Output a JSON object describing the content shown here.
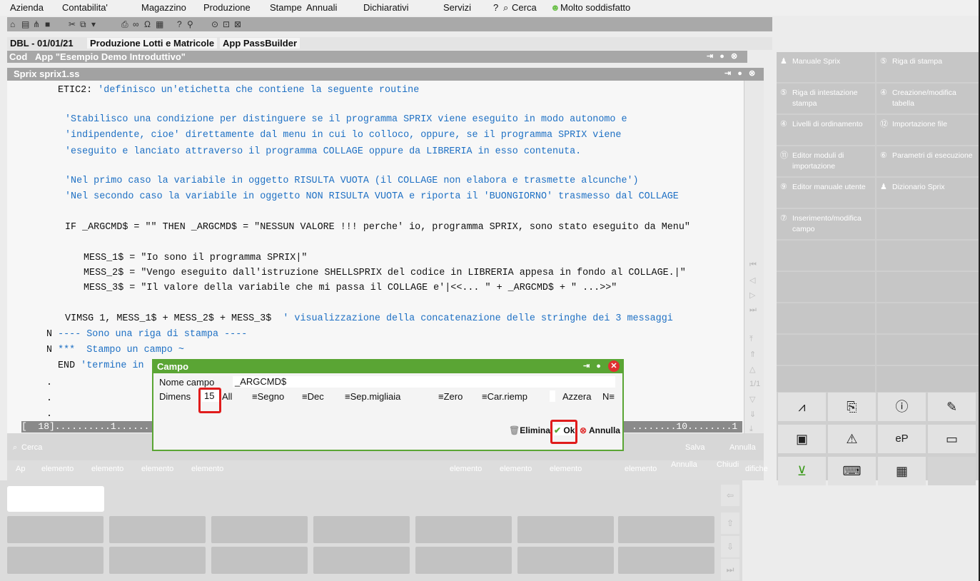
{
  "menubar": {
    "items": [
      "Azienda",
      "Contabilita'",
      "Magazzino",
      "Produzione",
      "Stampe",
      "Annuali",
      "Dichiarativi",
      "Servizi",
      "?",
      "Cerca",
      "Molto soddisfatto"
    ]
  },
  "appbar": {
    "date": "DBL - 01/01/21",
    "tab1": "Produzione Lotti e Matricole",
    "tab2": "App PassBuilder"
  },
  "window": {
    "prefix": "Cod",
    "title": "App \"Esempio Demo Introduttivo\""
  },
  "sprix": {
    "title": "Sprix sprix1.ss"
  },
  "code": {
    "l1a": "ETIC2: ",
    "l1b": "'definisco un'etichetta che contiene la seguente routine",
    "l2": "'Stabilisco una condizione per distinguere se il programma SPRIX viene eseguito in modo autonomo e",
    "l3": "'indipendente, cioe' direttamente dal menu in cui lo colloco, oppure, se il programma SPRIX viene",
    "l4": "'eseguito e lanciato attraverso il programma COLLAGE oppure da LIBRERIA in esso contenuta.",
    "l5": "'Nel primo caso la variabile in oggetto RISULTA VUOTA (il COLLAGE non elabora e trasmette alcunche')",
    "l6": "'Nel secondo caso la variabile in oggetto NON RISULTA VUOTA e riporta il 'BUONGIORNO' trasmesso dal COLLAGE",
    "l7": "IF _ARGCMD$ = \"\" THEN _ARGCMD$ = \"NESSUN VALORE !!! perche' io, programma SPRIX, sono stato eseguito da Menu\"",
    "l8": "MESS_1$ = \"Io sono il programma SPRIX|\"",
    "l9": "MESS_2$ = \"Vengo eseguito dall'istruzione SHELLSPRIX del codice in LIBRERIA appesa in fondo al COLLAGE.|\"",
    "l10": "MESS_3$ = \"Il valore della variabile che mi passa il COLLAGE e'|<<... \" + _ARGCMD$ + \" ...>>\"",
    "l11a": "VIMSG 1, MESS_1$ + MESS_2$ + MESS_3$  ",
    "l11b": "' visualizzazione della concatenazione delle stringhe dei 3 messaggi",
    "l12n": "N",
    "l12": "---- Sono una riga di stampa ----",
    "l13n": "N",
    "l13": "***  Stampo un campo ~",
    "l14a": "END ",
    "l14b": "'termine in",
    "dot": "."
  },
  "ruler": {
    "left": "[  18]..........1......",
    "right": "........10........1"
  },
  "bottom": {
    "search": "Cerca",
    "save": "Salva",
    "cancel": "Annulla"
  },
  "btnrow": {
    "b1": "Ap",
    "b2": "elemento",
    "b3": "elemento",
    "b4": "elemento",
    "b5": "elemento",
    "b6": "elemento",
    "b7": "elemento",
    "b8": "elemento",
    "b9": "elemento",
    "b10": "Annulla",
    "b11": "Chiudi",
    "b12": "difiche"
  },
  "rpanel": {
    "c1": "Manuale Sprix",
    "c2": "Riga di stampa",
    "c3": "Riga di intestazione stampa",
    "c4": "Creazione/modifica tabella",
    "c5": "Livelli di ordinamento",
    "c6": "Importazione file",
    "c7": "Editor moduli di importazione",
    "c8": "Parametri di esecuzione",
    "c9": "Editor manuale utente",
    "c10": "Dizionario Sprix",
    "c11": "Inserimento/modifica campo"
  },
  "dialog": {
    "title": "Campo",
    "nome_label": "Nome campo",
    "nome_value": "_ARGCMD$",
    "dimens_label": "Dimens",
    "dimens_value": "15",
    "all": "All",
    "segno": "Segno",
    "dec": "Dec",
    "sepmig": "Sep.migliaia",
    "zero": "Zero",
    "carriemp": "Car.riemp",
    "azzera": "Azzera",
    "azzera_value": "N",
    "elimina": "Elimina",
    "ok": "Ok",
    "annulla": "Annulla"
  },
  "colors": {
    "accent_green": "#5aa534",
    "code_blue": "#1e70c4",
    "highlight_red": "#e01c1c"
  }
}
